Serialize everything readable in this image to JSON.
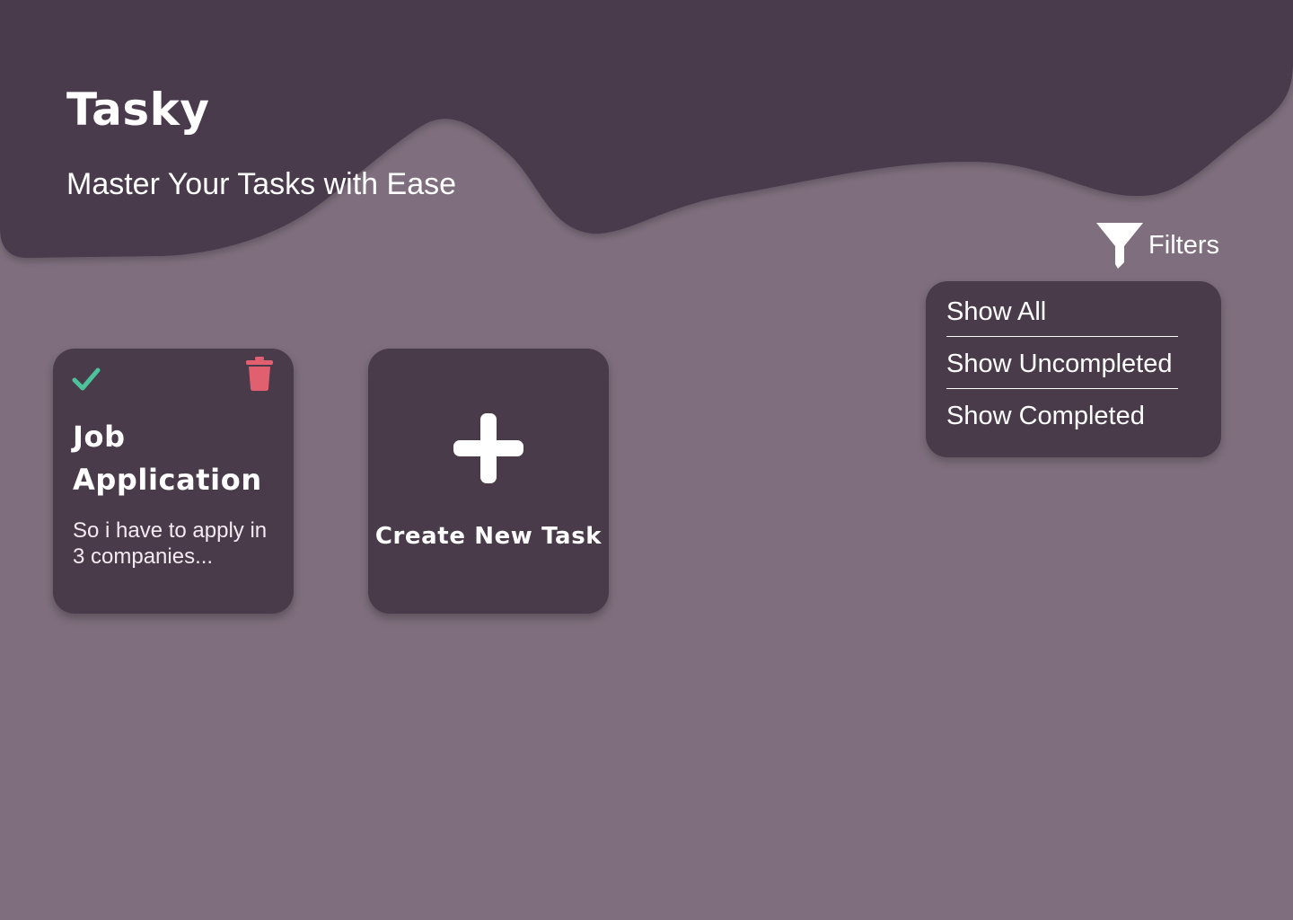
{
  "header": {
    "title": "Tasky",
    "subtitle": "Master Your Tasks with Ease"
  },
  "filters": {
    "label": "Filters",
    "icon": "filter-icon",
    "options": [
      "Show All",
      "Show Uncompleted",
      "Show Completed"
    ]
  },
  "tasks": [
    {
      "title": "Job Application",
      "description": "So i have to apply in 3 companies...",
      "completed": true
    }
  ],
  "create": {
    "label": "Create New Task",
    "icon": "plus-icon"
  },
  "colors": {
    "background": "#7f6f7e",
    "surface": "#4a3b4b",
    "text": "#ffffff",
    "check": "#4cc29a",
    "delete": "#e0606f"
  }
}
